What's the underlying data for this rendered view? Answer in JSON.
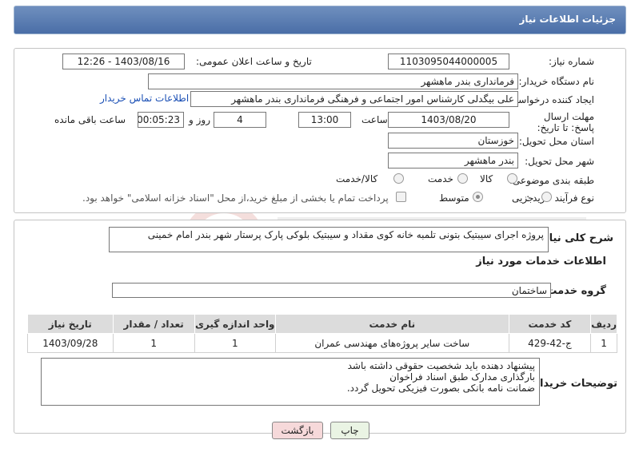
{
  "header": {
    "title": "جزئیات اطلاعات نیاز"
  },
  "form": {
    "need_number_label": "شماره نیاز:",
    "need_number": "1103095044000005",
    "announce_label": "تاریخ و ساعت اعلان عمومی:",
    "announce_value": "1403/08/16 - 12:26",
    "buyer_org_label": "نام دستگاه خریدار:",
    "buyer_org": "فرمانداری بندر ماهشهر",
    "creator_label": "ایجاد کننده درخواست:",
    "creator": "علی بیگدلی کارشناس امور اجتماعی و فرهنگی فرمانداری بندر ماهشهر",
    "contact_link": "اطلاعات تماس خریدار",
    "deadline_label": "مهلت ارسال پاسخ: تا تاریخ:",
    "deadline_date": "1403/08/20",
    "time_label": "ساعت",
    "deadline_time": "13:00",
    "days_value": "4",
    "days_label": "روز و",
    "remaining_time": "00:05:23",
    "remaining_label": "ساعت باقی مانده",
    "province_label": "استان محل تحویل:",
    "province": "خوزستان",
    "city_label": "شهر محل تحویل:",
    "city": "بندر ماهشهر",
    "category_label": "طبقه بندی موضوعی:",
    "category_options": [
      "کالا",
      "خدمت",
      "کالا/خدمت"
    ],
    "process_label": "نوع فرآیند خرید :",
    "process_options": [
      "جزیی",
      "متوسط"
    ],
    "payment_note": "پرداخت تمام یا بخشی از مبلغ خرید،از محل \"اسناد خزانه اسلامی\" خواهد بود."
  },
  "summary": {
    "label": "شرح کلی نیاز:",
    "text": "پروژه اجرای سیبتیک بتونی تلمبه خانه کوی مقداد و سیبتیک بلوکی پارک پرستار شهر بندر امام خمینی"
  },
  "services": {
    "title": "اطلاعات خدمات مورد نیاز",
    "group_label": "گروه خدمت:",
    "group_value": "ساختمان",
    "columns": [
      "ردیف",
      "کد خدمت",
      "نام خدمت",
      "واحد اندازه گیری",
      "تعداد / مقدار",
      "تاریخ نیاز"
    ],
    "rows": [
      [
        "1",
        "ج-42-429",
        "ساخت سایر پروژه‌های مهندسی عمران",
        "1",
        "1",
        "1403/09/28"
      ]
    ]
  },
  "notes": {
    "label": "توضیحات خریدار:",
    "lines": [
      "پیشنهاد دهنده باید شخصیت حقوقی داشته باشد",
      "بارگذاری مدارک طبق اسناد فراخوان",
      "ضمانت نامه بانکی بصورت فیزیکی تحویل گردد."
    ]
  },
  "buttons": {
    "print": "چاپ",
    "back": "بازگشت"
  },
  "colors": {
    "header_bg": "#5a7db3",
    "back_btn": "#f6d9da",
    "print_btn": "#eaf4e4"
  }
}
